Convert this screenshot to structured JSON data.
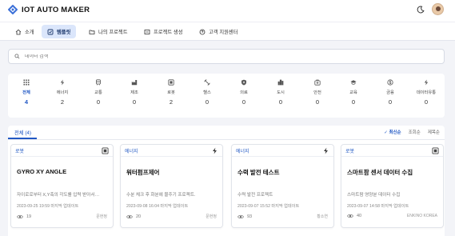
{
  "app": {
    "title": "IOT AUTO MAKER",
    "brand_color": "#3a6fd8"
  },
  "nav": {
    "items": [
      {
        "label": "소개",
        "icon": "home-icon"
      },
      {
        "label": "템플릿",
        "icon": "template-icon",
        "active": true
      },
      {
        "label": "나의 프로젝트",
        "icon": "folder-icon"
      },
      {
        "label": "프로젝트 생성",
        "icon": "create-icon"
      },
      {
        "label": "고객 지원센터",
        "icon": "help-icon"
      }
    ]
  },
  "search": {
    "placeholder": "데이터 검색",
    "value": ""
  },
  "categories": [
    {
      "label": "전체",
      "count": "4",
      "icon": "grid-icon",
      "active": true
    },
    {
      "label": "에너지",
      "count": "2",
      "icon": "lightning-icon"
    },
    {
      "label": "교통",
      "count": "0",
      "icon": "train-icon"
    },
    {
      "label": "제조",
      "count": "0",
      "icon": "factory-icon"
    },
    {
      "label": "로봇",
      "count": "2",
      "icon": "robot-icon"
    },
    {
      "label": "헬스",
      "count": "0",
      "icon": "dumbbell-icon"
    },
    {
      "label": "의료",
      "count": "0",
      "icon": "shield-plus-icon"
    },
    {
      "label": "도시",
      "count": "0",
      "icon": "city-icon"
    },
    {
      "label": "안전",
      "count": "0",
      "icon": "safety-icon"
    },
    {
      "label": "교육",
      "count": "0",
      "icon": "graduation-icon"
    },
    {
      "label": "금융",
      "count": "0",
      "icon": "coin-icon"
    },
    {
      "label": "데이터유통",
      "count": "0",
      "icon": "lightning-icon"
    }
  ],
  "list": {
    "tab_all": "전체 (4)",
    "sort": [
      "최신순",
      "조회순",
      "제목순"
    ]
  },
  "cards": [
    {
      "category": "로봇",
      "icon": "robot-icon",
      "title": "GYRO XY ANGLE",
      "desc": "자이로로부터 X,Y축의 각도를 입력 받아서…",
      "date": "2023-09-25 19:59 마지막 업데이트",
      "views": "19",
      "author": "문현정"
    },
    {
      "category": "에너지",
      "icon": "lightning-icon",
      "title": "워터펌프제어",
      "desc": "수분 체크 후 화분에 물주기 프로젝트.",
      "date": "2023-09-08 16:04 마지막 업데이트",
      "views": "20",
      "author": "문현정"
    },
    {
      "category": "에너지",
      "icon": "lightning-icon",
      "title": "수력 발전 테스트",
      "desc": "수력 발전 프로젝트",
      "date": "2023-09-07 15:52 마지막 업데이트",
      "views": "93",
      "author": "황소연"
    },
    {
      "category": "로봇",
      "icon": "robot-icon",
      "title": "스마트팜 센서 데이터 수집",
      "desc": "스마트팜 영양분 데이터 수집",
      "date": "2023-09-07 14:58 마지막 업데이트",
      "views": "40",
      "author": "ENKINO KOREA"
    }
  ]
}
